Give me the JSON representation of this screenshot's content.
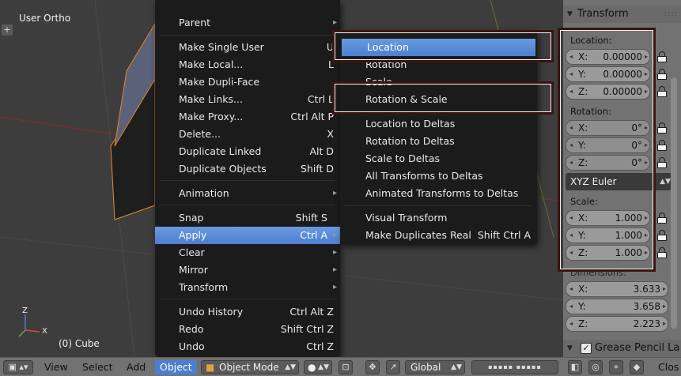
{
  "viewport": {
    "view_label": "User Ortho",
    "object_label": "(0) Cube",
    "plus_glyph": "+",
    "axis_z": "Z",
    "axis_x": "X"
  },
  "object_menu": {
    "items": [
      {
        "label": "Parent",
        "shortcut": ""
      },
      {
        "label": "Make Single User",
        "shortcut": "U"
      },
      {
        "label": "Make Local...",
        "shortcut": "L"
      },
      {
        "label": "Make Dupli-Face",
        "shortcut": ""
      },
      {
        "label": "Make Links...",
        "shortcut": "Ctrl L"
      },
      {
        "label": "Make Proxy...",
        "shortcut": "Ctrl Alt P"
      },
      {
        "label": "Delete...",
        "shortcut": "X"
      },
      {
        "label": "Duplicate Linked",
        "shortcut": "Alt D"
      },
      {
        "label": "Duplicate Objects",
        "shortcut": "Shift D"
      },
      {
        "label": "Animation",
        "shortcut": ""
      },
      {
        "label": "Snap",
        "shortcut": "Shift S"
      },
      {
        "label": "Apply",
        "shortcut": "Ctrl A"
      },
      {
        "label": "Clear",
        "shortcut": ""
      },
      {
        "label": "Mirror",
        "shortcut": ""
      },
      {
        "label": "Transform",
        "shortcut": ""
      },
      {
        "label": "Undo History",
        "shortcut": "Ctrl Alt Z"
      },
      {
        "label": "Redo",
        "shortcut": "Shift Ctrl Z"
      },
      {
        "label": "Undo",
        "shortcut": "Ctrl Z"
      }
    ]
  },
  "apply_menu": {
    "items": [
      {
        "label": "Location",
        "shortcut": ""
      },
      {
        "label": "Rotation",
        "shortcut": ""
      },
      {
        "label": "Scale",
        "shortcut": ""
      },
      {
        "label": "Rotation & Scale",
        "shortcut": ""
      },
      {
        "label": "Location to Deltas",
        "shortcut": ""
      },
      {
        "label": "Rotation to Deltas",
        "shortcut": ""
      },
      {
        "label": "Scale to Deltas",
        "shortcut": ""
      },
      {
        "label": "All Transforms to Deltas",
        "shortcut": ""
      },
      {
        "label": "Animated Transforms to Deltas",
        "shortcut": ""
      },
      {
        "label": "Visual Transform",
        "shortcut": ""
      },
      {
        "label": "Make Duplicates Real",
        "shortcut": "Shift Ctrl A"
      }
    ]
  },
  "panel": {
    "transform_title": "Transform",
    "location_label": "Location:",
    "location": [
      {
        "axis": "X:",
        "value": "0.00000"
      },
      {
        "axis": "Y:",
        "value": "0.00000"
      },
      {
        "axis": "Z:",
        "value": "0.00000"
      }
    ],
    "rotation_label": "Rotation:",
    "rotation": [
      {
        "axis": "X:",
        "value": "0°"
      },
      {
        "axis": "Y:",
        "value": "0°"
      },
      {
        "axis": "Z:",
        "value": "0°"
      }
    ],
    "rotation_mode": "XYZ Euler",
    "scale_label": "Scale:",
    "scale": [
      {
        "axis": "X:",
        "value": "1.000"
      },
      {
        "axis": "Y:",
        "value": "1.000"
      },
      {
        "axis": "Z:",
        "value": "1.000"
      }
    ],
    "dimensions_label": "Dimensions:",
    "dimensions": [
      {
        "axis": "X:",
        "value": "3.633"
      },
      {
        "axis": "Y:",
        "value": "3.658"
      },
      {
        "axis": "Z:",
        "value": "2.223"
      }
    ],
    "grease_title": "Grease Pencil La",
    "check_glyph": "✓"
  },
  "header": {
    "view": "View",
    "select": "Select",
    "add": "Add",
    "object": "Object",
    "mode": "Object Mode",
    "orientation": "Global",
    "close": "Clos"
  },
  "colors": {
    "menu_bg": "#1b1b1b",
    "highlight": "#5b8bd9",
    "annotation": "#3a1414",
    "panel_bg": "#727272"
  }
}
